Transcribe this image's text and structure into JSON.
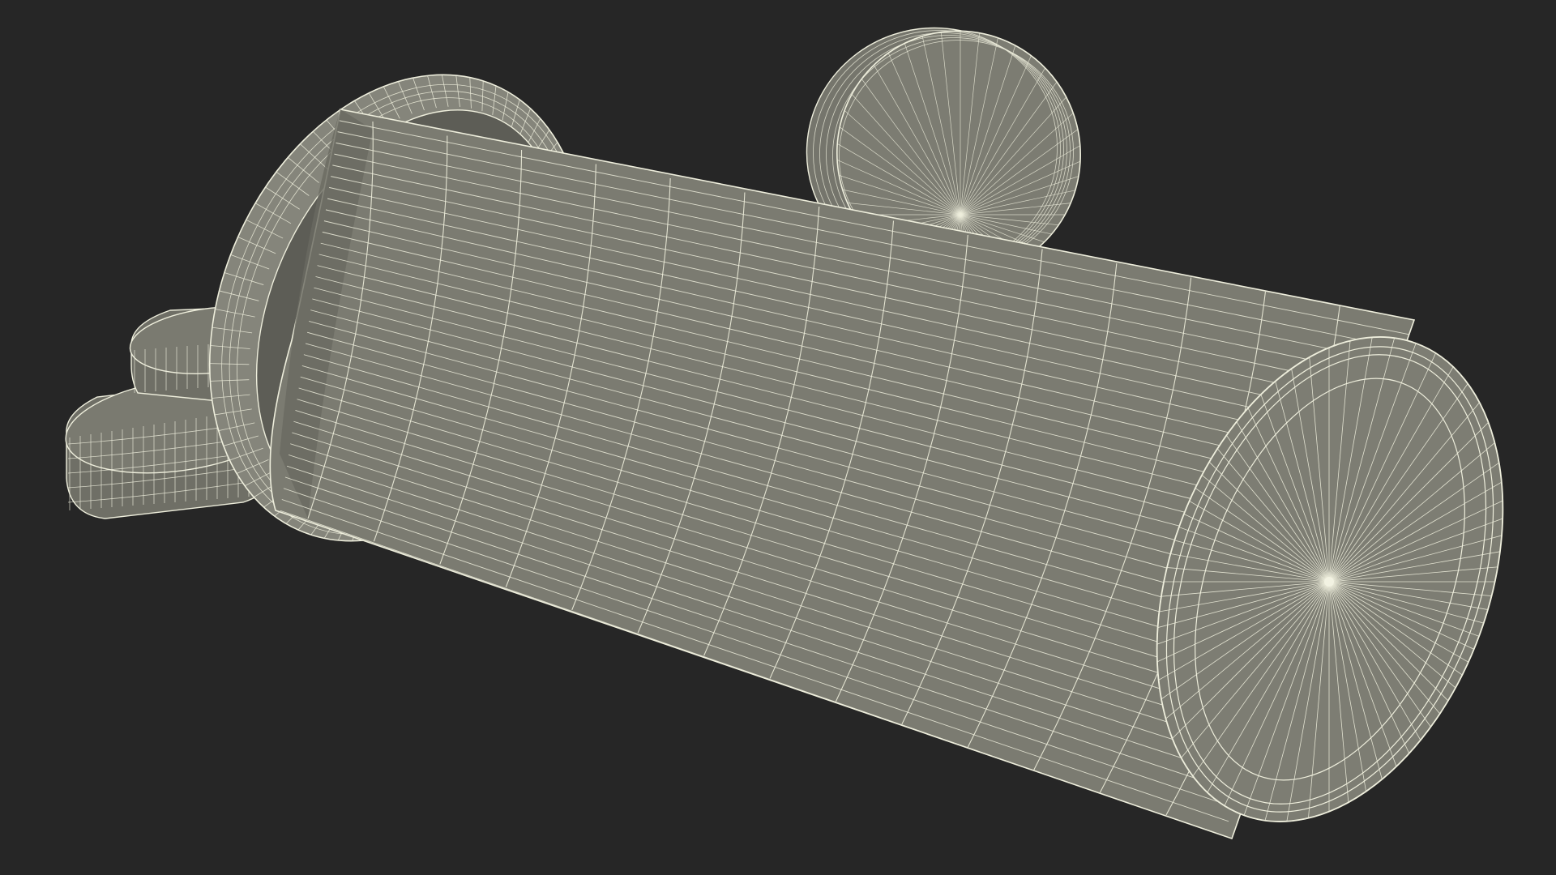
{
  "scene": {
    "background_color": "#262626",
    "surface_color": "#7a7a70",
    "surface_dark_color": "#6c6c63",
    "rim_color": "#85857b",
    "wire_color": "#eeeedc",
    "objects": [
      "back-lid-standing",
      "flat-lid-upper",
      "flat-lid-lower",
      "open-rim-ring",
      "cylinder-body",
      "cylinder-end-cap"
    ]
  }
}
